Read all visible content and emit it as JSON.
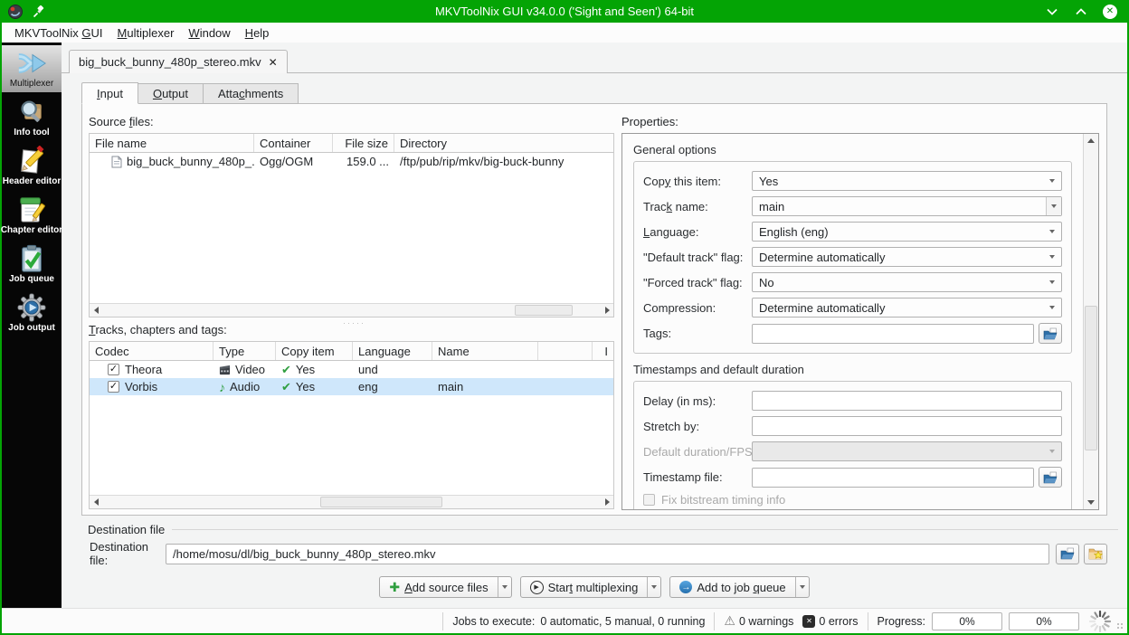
{
  "titlebar": {
    "title": "MKVToolNix GUI v34.0.0 ('Sight and Seen') 64-bit"
  },
  "icons": {
    "close_window": "✕",
    "tab_close": "✕",
    "checkmark": "✓",
    "copy_check": "✔",
    "music_note": "♪",
    "warning": "⚠",
    "error_x": "✕",
    "plus": "✚",
    "play": "▶",
    "queue_arrow": "→",
    "splitter_dots": "·····"
  },
  "menubar": {
    "items": [
      "MKVToolNix &GUI",
      "&Multiplexer",
      "&Window",
      "&Help"
    ]
  },
  "sidebar": {
    "items": [
      {
        "label": "Multiplexer",
        "icon": "merge-arrows-icon",
        "selected": true
      },
      {
        "label": "Info tool",
        "icon": "magnifier-box-icon",
        "selected": false
      },
      {
        "label": "Header editor",
        "icon": "pencil-page-icon",
        "selected": false
      },
      {
        "label": "Chapter editor",
        "icon": "notepad-pencil-icon",
        "selected": false
      },
      {
        "label": "Job queue",
        "icon": "clipboard-check-icon",
        "selected": false
      },
      {
        "label": "Job output",
        "icon": "gear-play-icon",
        "selected": false
      }
    ]
  },
  "document_tab": {
    "label": "big_buck_bunny_480p_stereo.mkv"
  },
  "subtabs": [
    "&Input",
    "&Output",
    "Atta&chments"
  ],
  "input_tab": {
    "source_files": {
      "label": "Source &files:",
      "columns": [
        "File name",
        "Container",
        "File size",
        "Directory"
      ],
      "rows": [
        {
          "file_name": "big_buck_bunny_480p_...",
          "container": "Ogg/OGM",
          "file_size": "159.0 ...",
          "directory": "/ftp/pub/rip/mkv/big-buck-bunny"
        }
      ]
    },
    "tracks": {
      "label": "&Tracks, chapters and tags:",
      "columns": [
        "Codec",
        "Type",
        "Copy item",
        "Language",
        "Name",
        "",
        "I"
      ],
      "rows": [
        {
          "checked": true,
          "codec": "Theora",
          "type": "Video",
          "copy_item": "Yes",
          "language": "und",
          "name": ""
        },
        {
          "checked": true,
          "codec": "Vorbis",
          "type": "Audio",
          "copy_item": "Yes",
          "language": "eng",
          "name": "main"
        }
      ]
    },
    "properties": {
      "label": "Properties:",
      "general": {
        "title": "General options",
        "copy_this_item": {
          "label": "Cop&y this item:",
          "value": "Yes"
        },
        "track_name": {
          "label": "Trac&k name:",
          "value": "main"
        },
        "language": {
          "label": "&Language:",
          "value": "English (eng)"
        },
        "default_track_flag": {
          "label": "\"Default track\" flag:",
          "value": "Determine automatically"
        },
        "forced_track_flag": {
          "label": "\"Forced track\" flag:",
          "value": "No"
        },
        "compression": {
          "label": "Compression:",
          "value": "Determine automatically"
        },
        "tags": {
          "label": "Tags:",
          "value": ""
        }
      },
      "timestamps": {
        "title": "Timestamps and default duration",
        "delay": {
          "label": "Delay (in ms):",
          "value": ""
        },
        "stretch_by": {
          "label": "Stretch by:",
          "value": ""
        },
        "default_duration": {
          "label": "Default duration/FPS:",
          "value": ""
        },
        "timestamp_file": {
          "label": "Timestamp file:",
          "value": ""
        },
        "fix_bitstream": {
          "label": "Fix bitstream timing info"
        }
      }
    }
  },
  "destination": {
    "group_title": "Destination file",
    "label": "Destination file:",
    "value": "/home/mosu/dl/big_buck_bunny_480p_stereo.mkv"
  },
  "actions": {
    "add_source_files": "&Add source files",
    "start_multiplexing": "Star&t multiplexing",
    "add_to_job_queue": "Add to job &queue"
  },
  "statusbar": {
    "jobs_label": "Jobs to execute:",
    "jobs_value": "0 automatic, 5 manual, 0 running",
    "warnings": "0 warnings",
    "errors": "0 errors",
    "progress_label": "Progress:",
    "progress_current": "0%",
    "progress_total": "0%"
  }
}
